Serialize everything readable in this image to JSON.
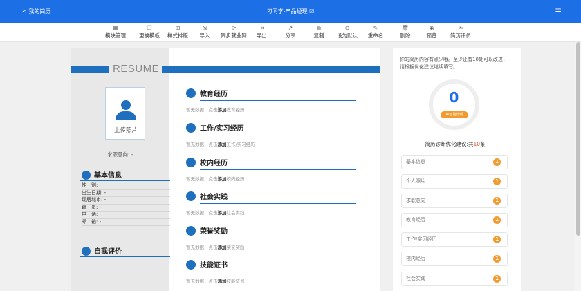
{
  "header": {
    "back_label": "< 我的简历",
    "title": "刁同学-产品经理 ☑",
    "menu_icon": "hamburger-icon"
  },
  "toolbar": [
    {
      "label": "模块管理",
      "icon": "grid-icon",
      "glyph": "▦"
    },
    {
      "label": "更换模板",
      "icon": "copy-icon",
      "glyph": "❐"
    },
    {
      "label": "样式排版",
      "icon": "layout-icon",
      "glyph": "⊞"
    },
    {
      "label": "导入",
      "icon": "import-icon",
      "glyph": "⇲"
    },
    {
      "label": "同步就业网",
      "icon": "sync-icon",
      "glyph": "⟳"
    },
    {
      "label": "导出",
      "icon": "export-icon",
      "glyph": "⇥"
    },
    {
      "label": "分享",
      "icon": "share-icon",
      "glyph": "↗"
    },
    {
      "label": "复制",
      "icon": "duplicate-icon",
      "glyph": "⧉"
    },
    {
      "label": "设为默认",
      "icon": "check-circle-icon",
      "glyph": "⊙"
    },
    {
      "label": "重命名",
      "icon": "edit-icon",
      "glyph": "✎"
    },
    {
      "label": "删除",
      "icon": "trash-icon",
      "glyph": "🗑"
    },
    {
      "label": "预览",
      "icon": "eye-icon",
      "glyph": "◉"
    },
    {
      "label": "简历评价",
      "icon": "review-icon",
      "glyph": "✍"
    }
  ],
  "resume": {
    "heading": "RESUME",
    "photo_label": "上传照片",
    "intent": "求职意向: -",
    "basic_title": "基本信息",
    "basic_rows": [
      "性　别: -",
      "出生日期: -",
      "现居城市: -",
      "籍　贯: -",
      "电　话: -",
      "邮　箱: -"
    ],
    "self_title": "自我评价",
    "sections": [
      {
        "title": "教育经历",
        "icon": "graduation-icon",
        "empty_pre": "暂无数据，点击",
        "add": "添加",
        "empty_post": "教育经历"
      },
      {
        "title": "工作/实习经历",
        "icon": "briefcase-icon",
        "empty_pre": "暂无数据，点击",
        "add": "添加",
        "empty_post": "工作/实习经历"
      },
      {
        "title": "校内经历",
        "icon": "book-icon",
        "empty_pre": "暂无数据，点击",
        "add": "添加",
        "empty_post": "校内经历"
      },
      {
        "title": "社会实践",
        "icon": "people-icon",
        "empty_pre": "暂无数据，点击",
        "add": "添加",
        "empty_post": "社会实践"
      },
      {
        "title": "荣誉奖励",
        "icon": "medal-icon",
        "empty_pre": "暂无数据，点击",
        "add": "添加",
        "empty_post": "荣誉奖励"
      },
      {
        "title": "技能证书",
        "icon": "gear-icon",
        "empty_pre": "暂无数据，点击",
        "add": "添加",
        "empty_post": "技能证书"
      }
    ]
  },
  "diagnosis": {
    "tip": "你的简历内容有点少哦。至少还有10处可以改进，请根据优化建议继续填写。",
    "score": "0",
    "badge": "AI智能诊断",
    "summary_pre": "简历诊断优化建议:共",
    "count": "10",
    "summary_post": "条",
    "items": [
      {
        "label": "基本信息",
        "count": "1"
      },
      {
        "label": "个人照片",
        "count": "1"
      },
      {
        "label": "求职意向",
        "count": "1"
      },
      {
        "label": "教育经历",
        "count": "1"
      },
      {
        "label": "工作/实习经历",
        "count": "1"
      },
      {
        "label": "校内经历",
        "count": "1"
      },
      {
        "label": "社会实践",
        "count": "1"
      }
    ],
    "accent": "#f29a2e",
    "brand": "#1d6fe6"
  }
}
